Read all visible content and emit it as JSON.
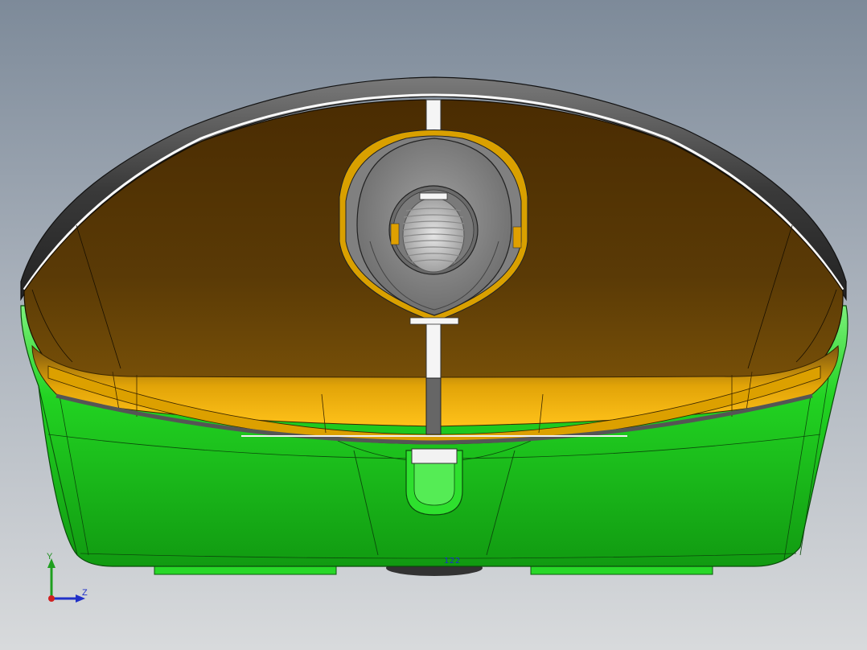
{
  "viewport": {
    "part_label": "122",
    "triad": {
      "y_label": "Y",
      "z_label": "Z"
    }
  },
  "colors": {
    "background_top": "#7d8a99",
    "background_bottom": "#d8dadc",
    "shell_green": "#22dd22",
    "cover_brown": "#5a3a06",
    "trim_gold": "#e0a000",
    "rim_dark": "#3a3a3a",
    "washer_gray": "#8a8a8a"
  }
}
